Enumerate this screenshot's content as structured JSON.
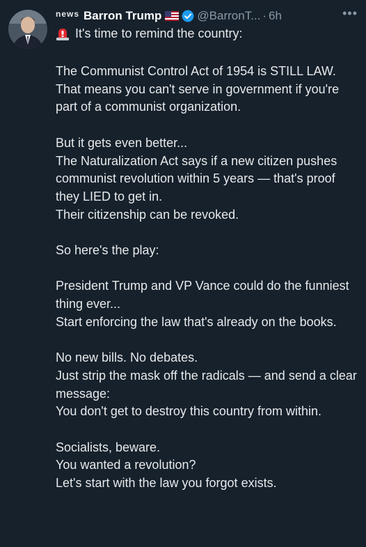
{
  "tweet": {
    "news_tag": "news",
    "display_name": "Barron Trump",
    "flag_icon": "us-flag-icon",
    "verified_icon": "verified-badge-icon",
    "handle": "@BarronT...",
    "separator": "·",
    "timestamp": "6h",
    "more_label": "•••",
    "intro_icon": "siren-icon",
    "intro_text": "It's time to remind the country:",
    "paragraphs": [
      "The Communist Control Act of 1954 is STILL LAW.\nThat means you can't serve in government if you're part of a communist organization.",
      "But it gets even better...\nThe Naturalization Act says if a new citizen pushes communist revolution within 5 years — that's proof they LIED to get in.\nTheir citizenship can be revoked.",
      "So here's the play:",
      "President Trump and VP Vance could do the funniest thing ever...\nStart enforcing the law that's already on the books.",
      "No new bills. No debates.\nJust strip the mask off the radicals — and send a clear message:\nYou don't get to destroy this country from within.",
      "Socialists, beware.\nYou wanted a revolution?\nLet's start with the law you forgot exists."
    ]
  },
  "colors": {
    "background": "#16212c",
    "text": "#e7e9ea",
    "muted": "#8b98a5",
    "verified": "#1d9bf0"
  }
}
